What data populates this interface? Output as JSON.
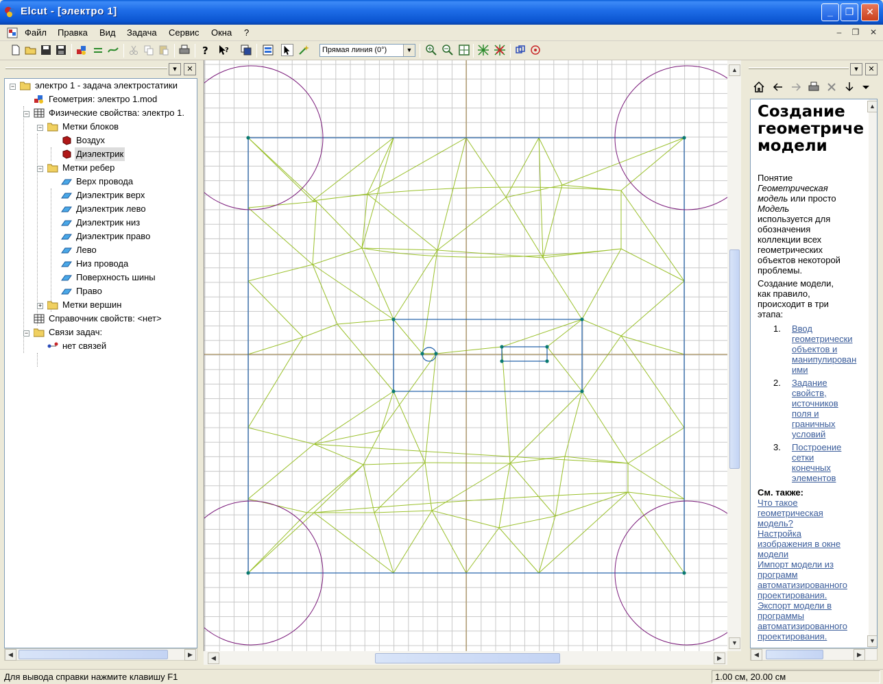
{
  "window": {
    "title": "Elcut - [электро 1]",
    "minimize": "_",
    "maximize": "❐",
    "close": "✕"
  },
  "menu": {
    "items": [
      "Файл",
      "Правка",
      "Вид",
      "Задача",
      "Сервис",
      "Окна",
      "?"
    ],
    "mdi_minimize": "–",
    "mdi_restore": "❐",
    "mdi_close": "✕"
  },
  "toolbar": {
    "shape_select_value": "Прямая линия (0°)"
  },
  "left_panel": {
    "close": "✕",
    "menu": "▾",
    "tree": {
      "root": "электро 1 - задача электростатики",
      "geometry": "Геометрия: электро 1.mod",
      "physics": "Физические свойства: электро 1.",
      "block_labels": "Метки блоков",
      "blocks": [
        "Воздух",
        "Диэлектрик"
      ],
      "edge_labels": "Метки ребер",
      "edges": [
        "Верх провода",
        "Диэлектрик верх",
        "Диэлектрик лево",
        "Диэлектрик низ",
        "Диэлектрик право",
        "Лево",
        "Низ провода",
        "Поверхность шины",
        "Право"
      ],
      "vertex_labels": "Метки вершин",
      "library": "Справочник свойств: <нет>",
      "links": "Связи задач:",
      "no_links": "нет связей"
    }
  },
  "help": {
    "title_lines": [
      "Создание",
      "геометриче",
      "модели"
    ],
    "p1_lines": [
      {
        "t": "Понятие",
        "i": false
      },
      {
        "t": "Геометрическая",
        "i": true
      },
      {
        "t": "модель",
        "i": true,
        "rest": " или просто"
      },
      {
        "t": "Модель",
        "i": true
      },
      {
        "t": "используется для",
        "i": false
      },
      {
        "t": "обозначения",
        "i": false
      },
      {
        "t": "коллекции всех",
        "i": false
      },
      {
        "t": "геометрических",
        "i": false
      },
      {
        "t": "объектов некоторой",
        "i": false
      },
      {
        "t": "проблемы.",
        "i": false
      }
    ],
    "p2_lines": [
      "Создание модели,",
      "как правило,",
      "происходит в три",
      "этапа:"
    ],
    "steps": [
      {
        "num": "1.",
        "lines": [
          "Ввод",
          "геометрически",
          "объектов и",
          "манипулирован",
          "ими"
        ]
      },
      {
        "num": "2.",
        "lines": [
          "Задание",
          "свойств,",
          "источников",
          "поля и",
          "граничных",
          "условий"
        ]
      },
      {
        "num": "3.",
        "lines": [
          "Построение",
          "сетки",
          "конечных",
          "элементов"
        ]
      }
    ],
    "see_also": "См. также:",
    "links": [
      [
        "Что такое",
        "геометрическая",
        "модель?"
      ],
      [
        "Настройка",
        "изображения в окне",
        "модели"
      ],
      [
        "Импорт модели из",
        "программ",
        "автоматизированного",
        "проектирования."
      ],
      [
        "Экспорт модели в",
        "программы",
        "автоматизированного",
        "проектирования."
      ]
    ]
  },
  "status": {
    "hint": "Для вывода справки нажмите клавишу F1",
    "coords": "1.00 см, 20.00 см"
  },
  "colors": {
    "grid": "#c8c8c8",
    "boundary": "#1f5fa8",
    "mesh": "#9ac02a",
    "circle": "#7a1a7a",
    "axis": "#a08040",
    "vertex": "#0a7a70"
  }
}
